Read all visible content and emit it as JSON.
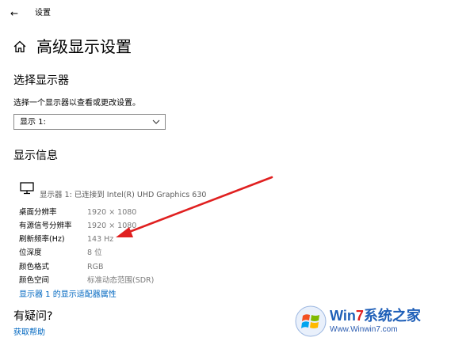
{
  "window": {
    "back_glyph": "←",
    "title": "设置"
  },
  "header": {
    "home_icon": "home-icon",
    "title": "高级显示设置"
  },
  "select_display": {
    "heading": "选择显示器",
    "description": "选择一个显示器以查看或更改设置。",
    "dropdown_value": "显示 1:",
    "dropdown_icon": "chevron-down-icon"
  },
  "display_info": {
    "heading": "显示信息",
    "monitor_icon": "monitor-icon",
    "monitor_name": "显示器 1: 已连接到 Intel(R) UHD Graphics 630",
    "rows": [
      {
        "label": "桌面分辨率",
        "value": "1920 × 1080"
      },
      {
        "label": "有源信号分辨率",
        "value": "1920 × 1080"
      },
      {
        "label": "刷新频率(Hz)",
        "value": "143 Hz"
      },
      {
        "label": "位深度",
        "value": "8 位"
      },
      {
        "label": "颜色格式",
        "value": "RGB"
      },
      {
        "label": "颜色空间",
        "value": "标准动态范围(SDR)"
      }
    ],
    "adapter_link": "显示器 1 的显示适配器属性"
  },
  "help": {
    "heading": "有疑问?",
    "link": "获取帮助"
  },
  "annotation": {
    "arrow_color": "#e02020"
  },
  "watermark": {
    "brand_win": "Win",
    "brand_7": "7",
    "brand_rest": "系统之家",
    "url": "Www.Winwin7.com",
    "logo_icon": "windows-logo-icon"
  },
  "colors": {
    "link": "#0067c0",
    "secondary_text": "#7a7a7a"
  }
}
